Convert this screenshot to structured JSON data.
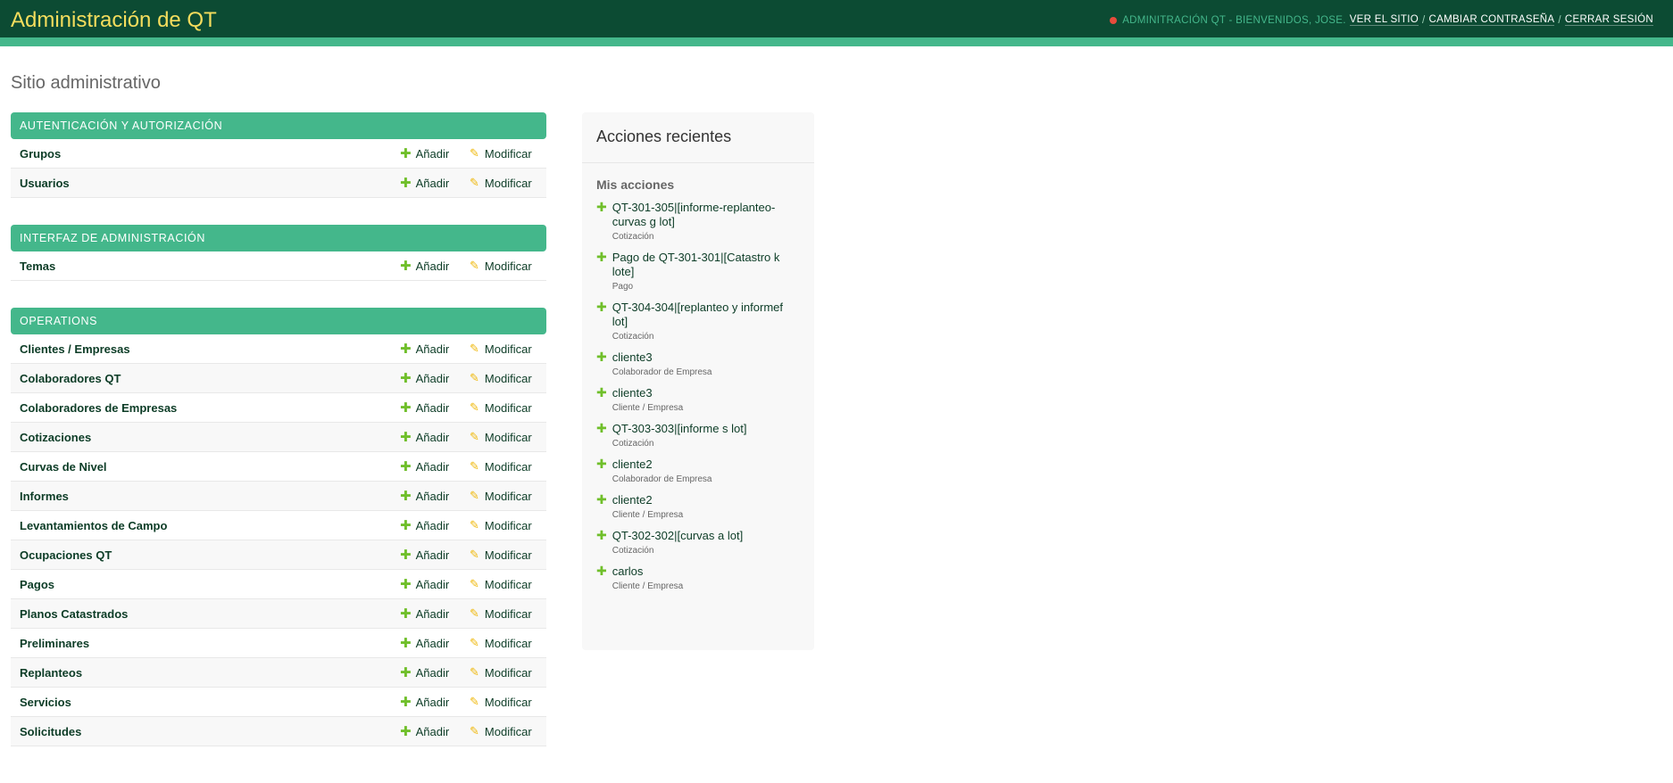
{
  "header": {
    "brand": "Administración de QT",
    "welcome": "ADMINITRACIÓN QT - BIENVENIDOS, JOSE.",
    "view_site": "VER EL SITIO",
    "change_password": "CAMBIAR CONTRASEÑA",
    "logout": "CERRAR SESIÓN",
    "separator": "/"
  },
  "page_title": "Sitio administrativo",
  "actions": {
    "add": "Añadir",
    "edit": "Modificar"
  },
  "modules": [
    {
      "caption": "AUTENTICACIÓN Y AUTORIZACIÓN",
      "models": [
        "Grupos",
        "Usuarios"
      ]
    },
    {
      "caption": "INTERFAZ DE ADMINISTRACIÓN",
      "models": [
        "Temas"
      ]
    },
    {
      "caption": "OPERATIONS",
      "models": [
        "Clientes / Empresas",
        "Colaboradores QT",
        "Colaboradores de Empresas",
        "Cotizaciones",
        "Curvas de Nivel",
        "Informes",
        "Levantamientos de Campo",
        "Ocupaciones QT",
        "Pagos",
        "Planos Catastrados",
        "Preliminares",
        "Replanteos",
        "Servicios",
        "Solicitudes"
      ]
    }
  ],
  "recent": {
    "title": "Acciones recientes",
    "subtitle": "Mis acciones",
    "items": [
      {
        "text": "QT-301-305|[informe-replanteo-curvas g lot]",
        "type": "Cotización"
      },
      {
        "text": "Pago de QT-301-301|[Catastro k lote]",
        "type": "Pago"
      },
      {
        "text": "QT-304-304|[replanteo y informef lot]",
        "type": "Cotización"
      },
      {
        "text": "cliente3",
        "type": "Colaborador de Empresa"
      },
      {
        "text": "cliente3",
        "type": "Cliente / Empresa"
      },
      {
        "text": "QT-303-303|[informe s lot]",
        "type": "Cotización"
      },
      {
        "text": "cliente2",
        "type": "Colaborador de Empresa"
      },
      {
        "text": "cliente2",
        "type": "Cliente / Empresa"
      },
      {
        "text": "QT-302-302|[curvas a lot]",
        "type": "Cotización"
      },
      {
        "text": "carlos",
        "type": "Cliente / Empresa"
      }
    ]
  },
  "colors": {
    "header_bg": "#0c4b33",
    "brand": "#f5dd5d",
    "accent": "#44b78b",
    "add_icon": "#70bf2b",
    "edit_icon": "#efb80b"
  }
}
